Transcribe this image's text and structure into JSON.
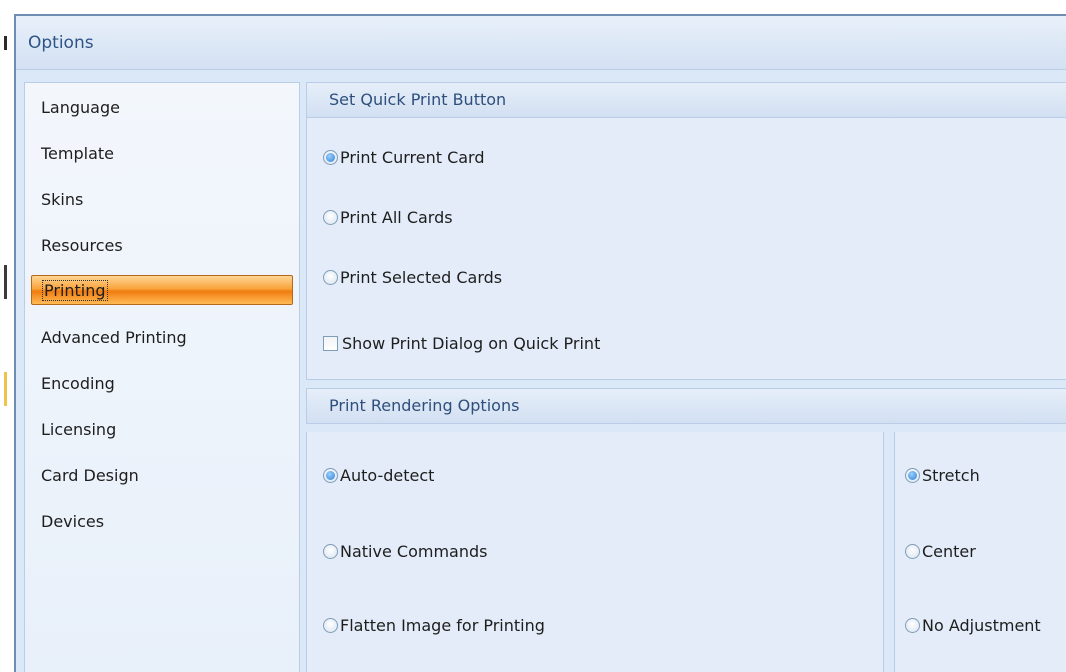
{
  "window": {
    "title": "Options"
  },
  "nav": {
    "items": [
      {
        "label": "Language"
      },
      {
        "label": "Template"
      },
      {
        "label": "Skins"
      },
      {
        "label": "Resources"
      },
      {
        "label": "Printing",
        "selected": true
      },
      {
        "label": "Advanced Printing"
      },
      {
        "label": "Encoding"
      },
      {
        "label": "Licensing"
      },
      {
        "label": "Card Design"
      },
      {
        "label": "Devices"
      }
    ]
  },
  "quick_print": {
    "header": "Set Quick Print Button",
    "options": [
      {
        "label": "Print Current Card",
        "checked": true
      },
      {
        "label": "Print All Cards",
        "checked": false
      },
      {
        "label": "Print Selected Cards",
        "checked": false
      }
    ],
    "show_dialog": {
      "label": "Show Print Dialog on Quick Print",
      "checked": false
    }
  },
  "rendering": {
    "header": "Print Rendering Options",
    "mode_options": [
      {
        "label": "Auto-detect",
        "checked": true
      },
      {
        "label": "Native Commands",
        "checked": false
      },
      {
        "label": "Flatten Image for Printing",
        "checked": false
      }
    ],
    "scale_options": [
      {
        "label": "Stretch",
        "checked": true
      },
      {
        "label": "Center",
        "checked": false
      },
      {
        "label": "No Adjustment",
        "checked": false
      }
    ]
  },
  "colors": {
    "accent": "#2e5487",
    "selection": "#f9a43c",
    "panel": "#e3ecf8"
  }
}
